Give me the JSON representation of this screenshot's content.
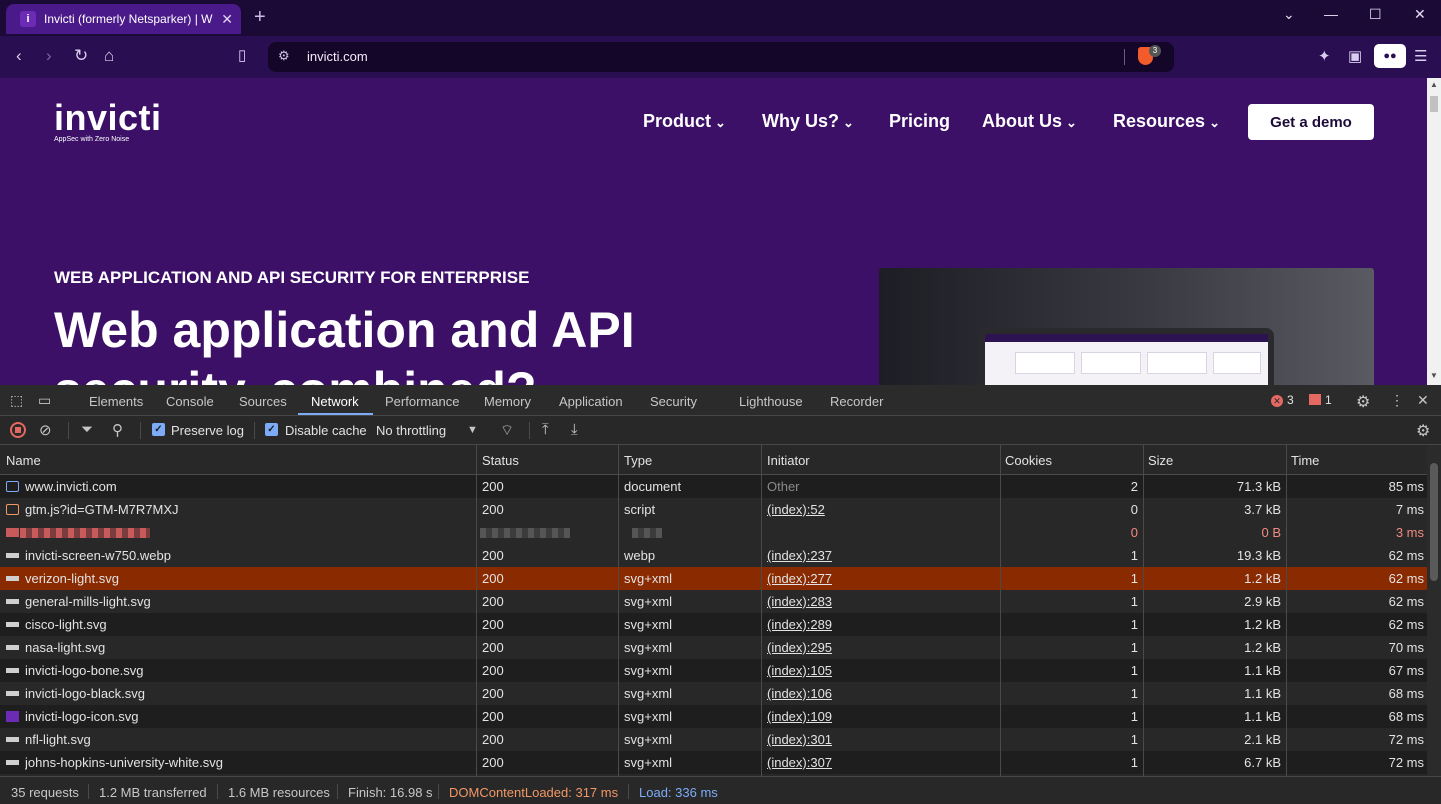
{
  "browser": {
    "tab_title": "Invicti (formerly Netsparker) | W",
    "tab_favicon": "i",
    "url": "invicti.com",
    "shield_count": "3"
  },
  "page": {
    "logo": "invicti",
    "logo_tagline": "AppSec with Zero Noise",
    "nav": [
      "Product",
      "Why Us?",
      "Pricing",
      "About Us",
      "Resources"
    ],
    "cta": "Get a demo",
    "eyebrow": "WEB APPLICATION AND API SECURITY FOR ENTERPRISE",
    "headline": "Web application and API security, combined?"
  },
  "devtools": {
    "tabs": [
      "Elements",
      "Console",
      "Sources",
      "Network",
      "Performance",
      "Memory",
      "Application",
      "Security",
      "Lighthouse",
      "Recorder"
    ],
    "active_tab": "Network",
    "error_count": "3",
    "issue_count": "1",
    "preserve_log": "Preserve log",
    "disable_cache": "Disable cache",
    "throttling": "No throttling",
    "columns": [
      "Name",
      "Status",
      "Type",
      "Initiator",
      "Cookies",
      "Size",
      "Time"
    ],
    "rows": [
      {
        "name": "www.invicti.com",
        "status": "200",
        "type": "document",
        "initiator": "Other",
        "cookies": "2",
        "size": "71.3 kB",
        "time": "85 ms",
        "icon": "document-icon"
      },
      {
        "name": "gtm.js?id=GTM-M7R7MXJ",
        "status": "200",
        "type": "script",
        "initiator": "(index):52",
        "cookies": "0",
        "size": "3.7 kB",
        "time": "7 ms",
        "icon": "script-icon"
      },
      {
        "name": "",
        "status": "",
        "type": "",
        "initiator": "",
        "cookies": "0",
        "size": "0 B",
        "time": "3 ms",
        "icon": "redacted-icon"
      },
      {
        "name": "invicti-screen-w750.webp",
        "status": "200",
        "type": "webp",
        "initiator": "(index):237",
        "cookies": "1",
        "size": "19.3 kB",
        "time": "62 ms",
        "icon": "image-icon"
      },
      {
        "name": "verizon-light.svg",
        "status": "200",
        "type": "svg+xml",
        "initiator": "(index):277",
        "cookies": "1",
        "size": "1.2 kB",
        "time": "62 ms",
        "icon": "image-icon"
      },
      {
        "name": "general-mills-light.svg",
        "status": "200",
        "type": "svg+xml",
        "initiator": "(index):283",
        "cookies": "1",
        "size": "2.9 kB",
        "time": "62 ms",
        "icon": "image-icon"
      },
      {
        "name": "cisco-light.svg",
        "status": "200",
        "type": "svg+xml",
        "initiator": "(index):289",
        "cookies": "1",
        "size": "1.2 kB",
        "time": "62 ms",
        "icon": "image-icon"
      },
      {
        "name": "nasa-light.svg",
        "status": "200",
        "type": "svg+xml",
        "initiator": "(index):295",
        "cookies": "1",
        "size": "1.2 kB",
        "time": "70 ms",
        "icon": "image-icon"
      },
      {
        "name": "invicti-logo-bone.svg",
        "status": "200",
        "type": "svg+xml",
        "initiator": "(index):105",
        "cookies": "1",
        "size": "1.1 kB",
        "time": "67 ms",
        "icon": "image-icon"
      },
      {
        "name": "invicti-logo-black.svg",
        "status": "200",
        "type": "svg+xml",
        "initiator": "(index):106",
        "cookies": "1",
        "size": "1.1 kB",
        "time": "68 ms",
        "icon": "image-icon"
      },
      {
        "name": "invicti-logo-icon.svg",
        "status": "200",
        "type": "svg+xml",
        "initiator": "(index):109",
        "cookies": "1",
        "size": "1.1 kB",
        "time": "68 ms",
        "icon": "logo-icon"
      },
      {
        "name": "nfl-light.svg",
        "status": "200",
        "type": "svg+xml",
        "initiator": "(index):301",
        "cookies": "1",
        "size": "2.1 kB",
        "time": "72 ms",
        "icon": "image-icon"
      },
      {
        "name": "johns-hopkins-university-white.svg",
        "status": "200",
        "type": "svg+xml",
        "initiator": "(index):307",
        "cookies": "1",
        "size": "6.7 kB",
        "time": "72 ms",
        "icon": "image-icon"
      }
    ],
    "status": {
      "requests": "35 requests",
      "transferred": "1.2 MB transferred",
      "resources": "1.6 MB resources",
      "finish": "Finish: 16.98 s",
      "dcl": "DOMContentLoaded: 317 ms",
      "load": "Load: 336 ms"
    }
  }
}
